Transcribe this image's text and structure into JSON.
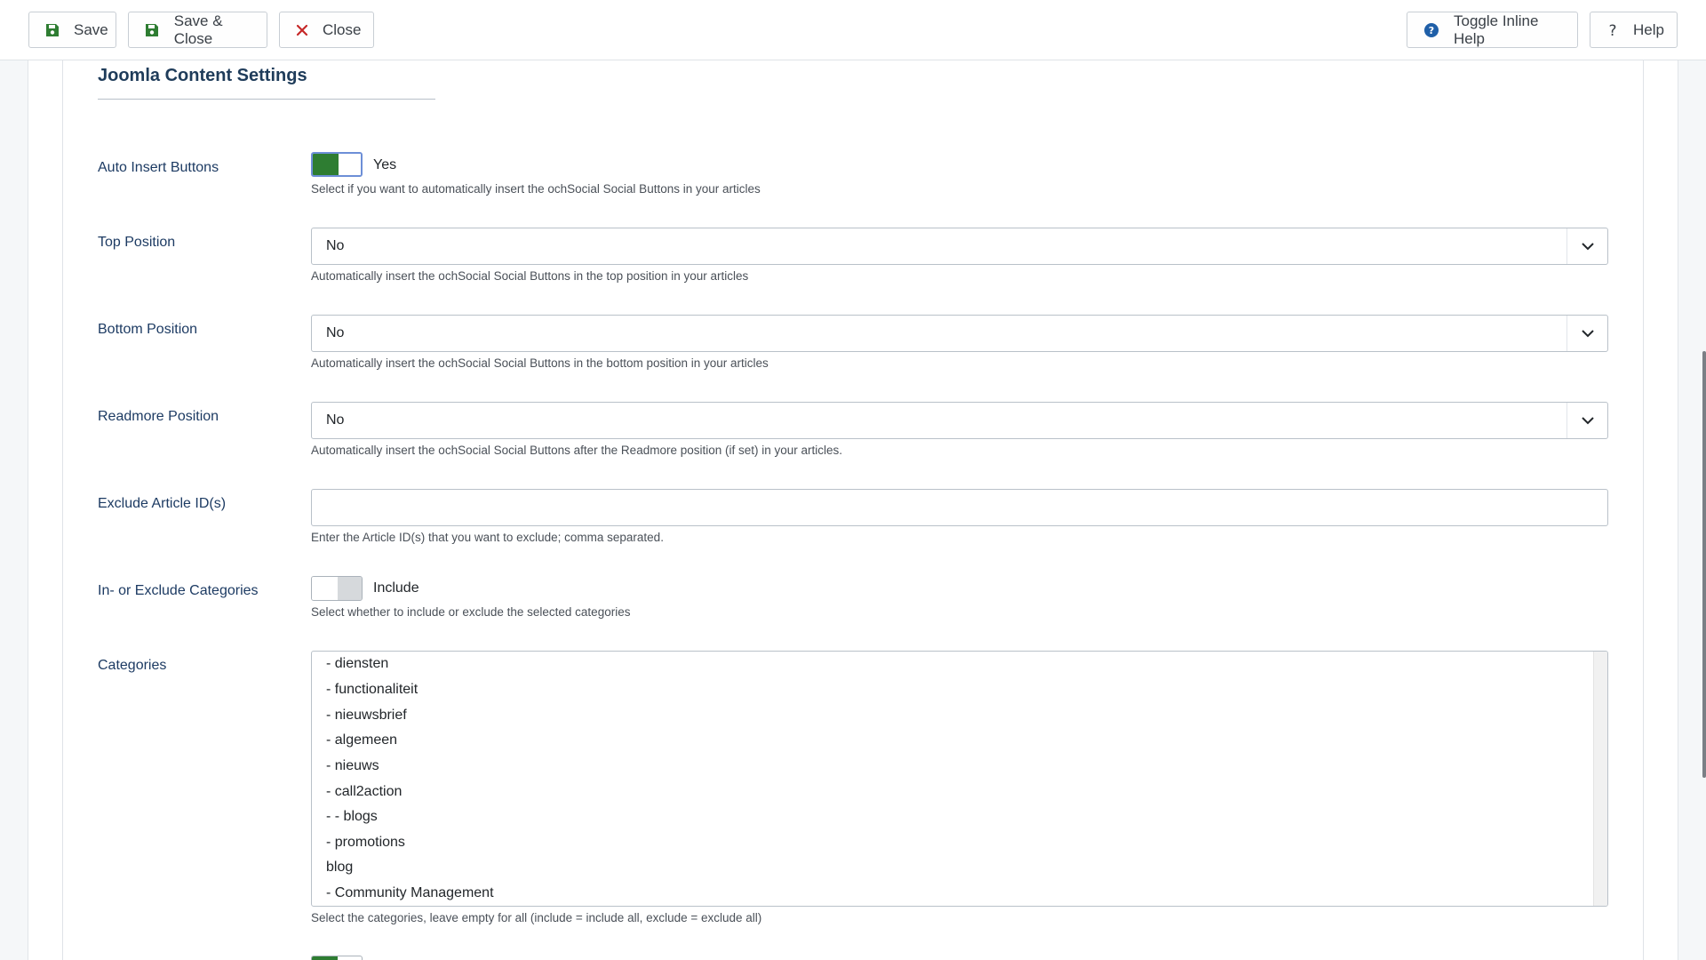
{
  "toolbar": {
    "save_label": "Save",
    "save_close_label": "Save & Close",
    "close_label": "Close",
    "toggle_help_label": "Toggle Inline Help",
    "help_label": "Help"
  },
  "section": {
    "title": "Joomla Content Settings"
  },
  "fields": {
    "auto_insert": {
      "label": "Auto Insert Buttons",
      "value": "Yes",
      "state": "on",
      "description": "Select if you want to automatically insert the ochSocial Social Buttons in your articles"
    },
    "top_position": {
      "label": "Top Position",
      "value": "No",
      "description": "Automatically insert the ochSocial Social Buttons in the top position in your articles"
    },
    "bottom_position": {
      "label": "Bottom Position",
      "value": "No",
      "description": "Automatically insert the ochSocial Social Buttons in the bottom position in your articles"
    },
    "readmore_position": {
      "label": "Readmore Position",
      "value": "No",
      "description": "Automatically insert the ochSocial Social Buttons after the Readmore position (if set) in your articles."
    },
    "exclude_ids": {
      "label": "Exclude Article ID(s)",
      "value": "",
      "description": "Enter the Article ID(s) that you want to exclude; comma separated."
    },
    "in_exclude_categories": {
      "label": "In- or Exclude Categories",
      "value": "Include",
      "state": "off",
      "description": "Select whether to include or exclude the selected categories"
    },
    "categories": {
      "label": "Categories",
      "items": [
        "- diensten",
        "- functionaliteit",
        "- nieuwsbrief",
        "- algemeen",
        "- nieuws",
        "- call2action",
        "- - blogs",
        "- promotions",
        "blog",
        "- Community Management"
      ],
      "description": "Select the categories, leave empty for all (include = include all, exclude = exclude all)"
    }
  },
  "colors": {
    "accent_green": "#2e7d32",
    "label_blue": "#1d3b63",
    "help_icon_blue": "#1f5fa8",
    "close_red": "#c62828"
  }
}
